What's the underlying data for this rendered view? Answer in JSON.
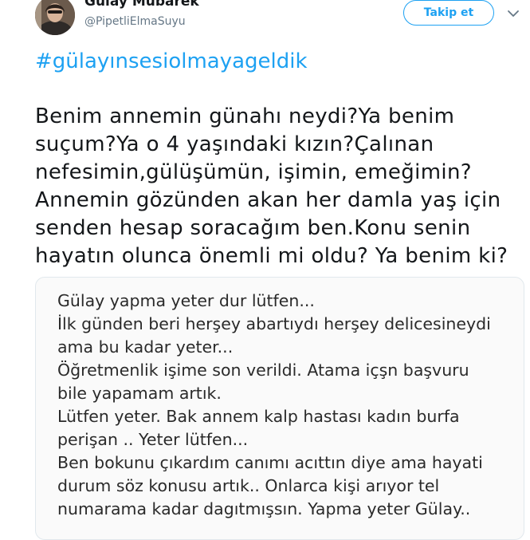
{
  "user": {
    "display_name": "Gülay Mübarek",
    "handle": "@PipetliElmaSuyu"
  },
  "actions": {
    "follow_label": "Takip et"
  },
  "tweet": {
    "hashtag": "#gülayınsesiolmayageldik",
    "text_lines": [
      "Benim annemin günahı neydi?Ya benim",
      "suçum?Ya o 4 yaşındaki kızın?Çalınan",
      "nefesimin,gülüşümün, işimin, emeğimin?",
      "Annemin gözünden akan her damla yaş için",
      "senden hesap soracağım ben.Konu senin",
      "hayatın olunca önemli mi oldu? Ya benim ki?"
    ]
  },
  "media": {
    "lines": [
      "Gülay yapma yeter dur lütfen...",
      "İlk günden beri herşey abartıydı herşey delicesineydi",
      "ama bu kadar yeter...",
      "Öğretmenlik işime son verildi. Atama içşn başvuru",
      "bile yapamam artık.",
      "Lütfen yeter. Bak annem kalp hastası kadın burfa",
      "perişan .. Yeter lütfen...",
      "Ben bokunu çıkardım canımı acıttın diye ama hayati",
      "durum söz konusu artık.. Onlarca kişi arıyor tel",
      "numarama kadar dagıtmışsın. Yapma yeter Gülay.."
    ]
  },
  "colors": {
    "accent": "#1da1f2",
    "text_primary": "#14171a",
    "text_secondary": "#657786",
    "card_border": "#e1e8ed"
  },
  "icons": {
    "caret": "chevron-down-icon",
    "avatar": "avatar"
  }
}
